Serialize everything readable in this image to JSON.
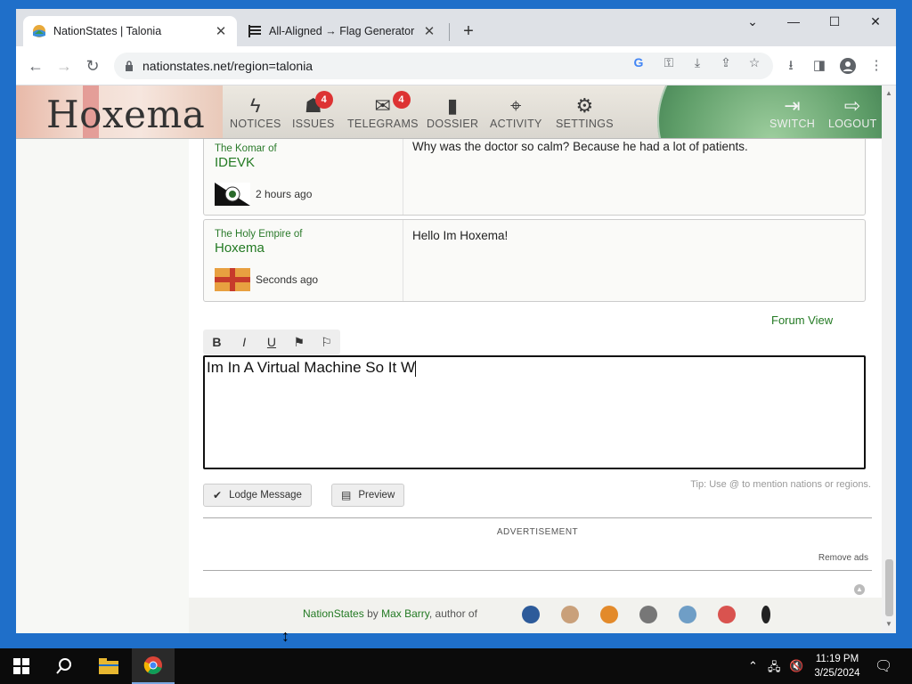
{
  "browser": {
    "tabs": [
      {
        "title": "NationStates | Talonia",
        "active": true
      },
      {
        "title": "All-Aligned → Flag Generator",
        "active": false
      }
    ],
    "new_tab": "+",
    "url": "nationstates.net/region=talonia",
    "window_controls": {
      "chevron": "⌄",
      "minimize": "—",
      "maximize": "☐",
      "close": "✕"
    }
  },
  "banner": {
    "nation_name": "Hoxema",
    "nav": [
      {
        "label": "NOTICES",
        "icon": "lightning-icon",
        "badge": ""
      },
      {
        "label": "ISSUES",
        "icon": "person-icon",
        "badge": "4"
      },
      {
        "label": "TELEGRAMS",
        "icon": "envelope-icon",
        "badge": "4"
      },
      {
        "label": "DOSSIER",
        "icon": "book-icon",
        "badge": ""
      },
      {
        "label": "ACTIVITY",
        "icon": "satellite-icon",
        "badge": ""
      },
      {
        "label": "SETTINGS",
        "icon": "gears-icon",
        "badge": ""
      }
    ],
    "switch_label": "SWITCH",
    "logout_label": "LOGOUT"
  },
  "messages": [
    {
      "pretitle": "The Komar of",
      "name": "IDEVK",
      "time": "2 hours ago",
      "text": "Why was the doctor so calm? Because he had a lot of patients."
    },
    {
      "pretitle": "The Holy Empire of",
      "name": "Hoxema",
      "time": "Seconds ago",
      "text": "Hello Im Hoxema!"
    }
  ],
  "forum_view": "Forum View",
  "editor": {
    "tools": [
      {
        "label": "B",
        "name": "bold-button"
      },
      {
        "label": "I",
        "name": "italic-button"
      },
      {
        "label": "U",
        "name": "underline-button"
      },
      {
        "label": "⚑",
        "name": "flag-filled-button"
      },
      {
        "label": "⚐",
        "name": "flag-outline-button"
      }
    ],
    "value": "Im In A Virtual Machine So It W",
    "tip": "Tip: Use @ to mention nations or regions.",
    "lodge_label": "Lodge Message",
    "preview_label": "Preview"
  },
  "advertisement_label": "ADVERTISEMENT",
  "remove_ads": "Remove ads",
  "footer": {
    "site": "NationStates",
    "by": "by",
    "author": "Max Barry",
    "author_of": ", author of"
  },
  "taskbar": {
    "time": "11:19 PM",
    "date": "3/25/2024"
  }
}
